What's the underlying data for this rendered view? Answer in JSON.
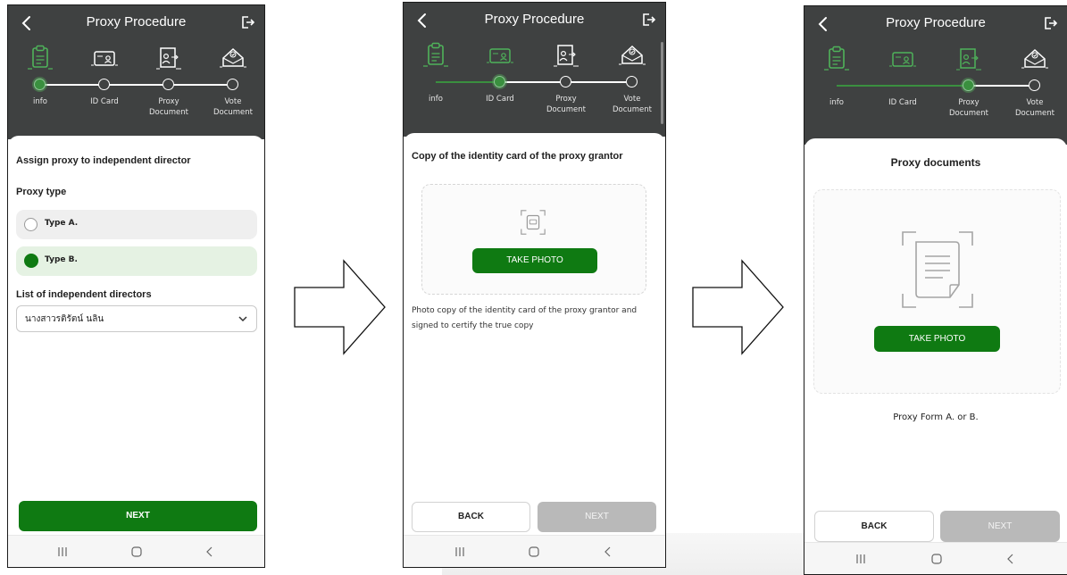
{
  "header": {
    "title": "Proxy Procedure",
    "icons": {
      "back": "chevron-left-icon",
      "exit": "logout-icon"
    }
  },
  "steps": [
    {
      "label": "info",
      "icon": "clipboard-icon"
    },
    {
      "label": "ID Card",
      "icon": "id-card-icon"
    },
    {
      "label": "Proxy\nDocument",
      "icon": "proxy-document-icon"
    },
    {
      "label": "Vote\nDocument",
      "icon": "vote-box-icon"
    }
  ],
  "screen1": {
    "heading": "Assign proxy to independent director",
    "proxy_type_label": "Proxy type",
    "options": [
      {
        "label": "Type A.",
        "selected": false
      },
      {
        "label": "Type B.",
        "selected": true
      }
    ],
    "directors_label": "List of independent directors",
    "director_selected": "นางสาวรติรัตน์ นลิน",
    "next_label": "NEXT",
    "current_step": 0
  },
  "screen2": {
    "heading": "Copy of the identity card of the proxy grantor",
    "take_photo_label": "TAKE PHOTO",
    "description": "Photo copy of the identity card of the proxy grantor and signed to certify the true copy",
    "back_label": "BACK",
    "next_label": "NEXT",
    "current_step": 1
  },
  "screen3": {
    "heading": "Proxy documents",
    "take_photo_label": "TAKE PHOTO",
    "caption": "Proxy Form A. or B.",
    "back_label": "BACK",
    "next_label": "NEXT",
    "current_step": 2
  },
  "nav": {
    "icons": [
      "recent-apps-icon",
      "home-icon",
      "back-icon"
    ]
  },
  "colors": {
    "header_bg": "#3f4141",
    "primary_green": "#0f7a12",
    "step_green": "#3a8f3f",
    "disabled_gray": "#b9b9b9",
    "selected_row_bg": "#e5f2e3",
    "unselected_row_bg": "#efefef"
  }
}
